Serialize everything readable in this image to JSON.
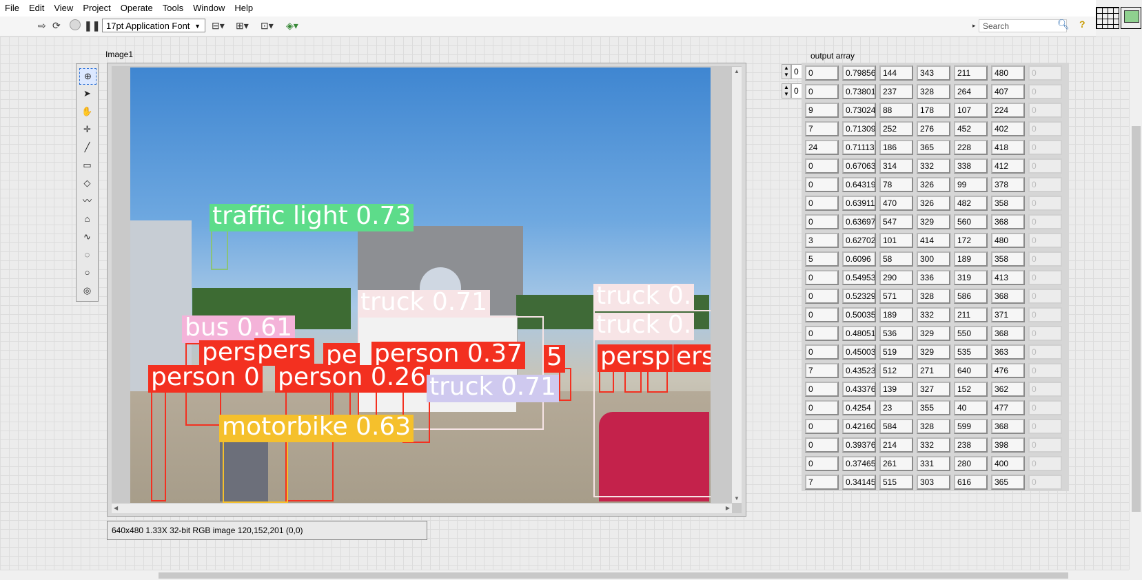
{
  "menu": [
    "File",
    "Edit",
    "View",
    "Project",
    "Operate",
    "Tools",
    "Window",
    "Help"
  ],
  "toolbar": {
    "font": "17pt Application Font",
    "search_placeholder": "Search",
    "run_icon": "run-arrow-icon",
    "run_continuous_icon": "run-continuously-icon",
    "abort_icon": "abort-icon",
    "pause_icon": "pause-icon",
    "align_icon": "align-objects-icon",
    "distribute_icon": "distribute-objects-icon",
    "resize_icon": "resize-objects-icon",
    "reorder_icon": "reorder-icon",
    "help_icon": "help-icon"
  },
  "image_label": "Image1",
  "image_status": "640x480 1.33X 32-bit RGB image 120,152,201     (0,0)",
  "palette_tools": [
    "zoom-tool-icon",
    "selection-arrow-icon",
    "pan-hand-icon",
    "point-tool-icon",
    "line-tool-icon",
    "rectangle-tool-icon",
    "rotated-rectangle-tool-icon",
    "polyline-tool-icon",
    "polygon-tool-icon",
    "freehand-line-tool-icon",
    "freehand-region-tool-icon",
    "oval-tool-icon",
    "annulus-tool-icon"
  ],
  "detections": [
    {
      "label": "traffic light 0.73",
      "color": "#5ddc8a"
    },
    {
      "label": "truck 0.71",
      "color": "#f7e4e6"
    },
    {
      "label": "truck 0.",
      "color": "#f7e4e6"
    },
    {
      "label": "truck 0.",
      "color": "#f7e4e6"
    },
    {
      "label": "bus 0.61",
      "color": "#f4b3d9"
    },
    {
      "label": "pers",
      "color": "#f33020"
    },
    {
      "label": "pers",
      "color": "#f33020"
    },
    {
      "label": "pe",
      "color": "#f33020"
    },
    {
      "label": "person 0.37",
      "color": "#f33020"
    },
    {
      "label": "5",
      "color": "#f33020"
    },
    {
      "label": "person 0",
      "color": "#f33020"
    },
    {
      "label": "person 0.26",
      "color": "#f33020"
    },
    {
      "label": "persp",
      "color": "#f33020"
    },
    {
      "label": "ers",
      "color": "#f33020"
    },
    {
      "label": "motorbike 0.63",
      "color": "#f5c02c"
    },
    {
      "label": "truck 0.71",
      "color": "#cfc9ef"
    }
  ],
  "output_array": {
    "label": "output array",
    "index0": "0",
    "index1": "0",
    "rows": [
      [
        "0",
        "0.79856",
        "144",
        "343",
        "211",
        "480",
        "0"
      ],
      [
        "0",
        "0.73801",
        "237",
        "328",
        "264",
        "407",
        "0"
      ],
      [
        "9",
        "0.73024",
        "88",
        "178",
        "107",
        "224",
        "0"
      ],
      [
        "7",
        "0.71309",
        "252",
        "276",
        "452",
        "402",
        "0"
      ],
      [
        "24",
        "0.71113",
        "186",
        "365",
        "228",
        "418",
        "0"
      ],
      [
        "0",
        "0.67063",
        "314",
        "332",
        "338",
        "412",
        "0"
      ],
      [
        "0",
        "0.64319",
        "78",
        "326",
        "99",
        "378",
        "0"
      ],
      [
        "0",
        "0.63911",
        "470",
        "326",
        "482",
        "358",
        "0"
      ],
      [
        "0",
        "0.63697",
        "547",
        "329",
        "560",
        "368",
        "0"
      ],
      [
        "3",
        "0.62702",
        "101",
        "414",
        "172",
        "480",
        "0"
      ],
      [
        "5",
        "0.6096",
        "58",
        "300",
        "189",
        "358",
        "0"
      ],
      [
        "0",
        "0.54953",
        "290",
        "336",
        "319",
        "413",
        "0"
      ],
      [
        "0",
        "0.52329",
        "571",
        "328",
        "586",
        "368",
        "0"
      ],
      [
        "0",
        "0.50035",
        "189",
        "332",
        "211",
        "371",
        "0"
      ],
      [
        "0",
        "0.48051",
        "536",
        "329",
        "550",
        "368",
        "0"
      ],
      [
        "0",
        "0.45003",
        "519",
        "329",
        "535",
        "363",
        "0"
      ],
      [
        "7",
        "0.43523",
        "512",
        "271",
        "640",
        "476",
        "0"
      ],
      [
        "0",
        "0.43376",
        "139",
        "327",
        "152",
        "362",
        "0"
      ],
      [
        "0",
        "0.4254",
        "23",
        "355",
        "40",
        "477",
        "0"
      ],
      [
        "0",
        "0.42160",
        "584",
        "328",
        "599",
        "368",
        "0"
      ],
      [
        "0",
        "0.39376",
        "214",
        "332",
        "238",
        "398",
        "0"
      ],
      [
        "0",
        "0.37465",
        "261",
        "331",
        "280",
        "400",
        "0"
      ],
      [
        "7",
        "0.34145",
        "515",
        "303",
        "616",
        "365",
        "0"
      ]
    ]
  }
}
